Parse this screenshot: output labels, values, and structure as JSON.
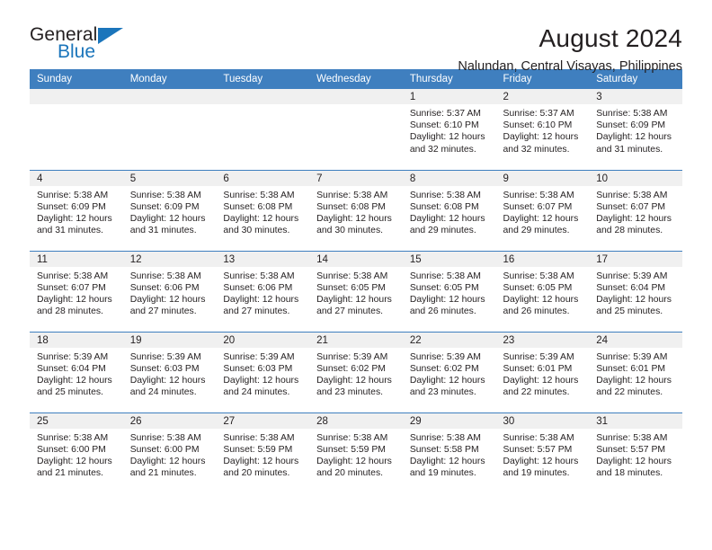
{
  "brand": {
    "name_top": "General",
    "name_bottom": "Blue",
    "accent_color": "#1b75bb"
  },
  "header": {
    "title": "August 2024",
    "subtitle": "Nalundan, Central Visayas, Philippines"
  },
  "calendar": {
    "header_bg": "#3f7fbf",
    "daynum_bg": "#f0f0f0",
    "weekdays": [
      "Sunday",
      "Monday",
      "Tuesday",
      "Wednesday",
      "Thursday",
      "Friday",
      "Saturday"
    ],
    "labels": {
      "sunrise": "Sunrise:",
      "sunset": "Sunset:",
      "daylight": "Daylight:"
    },
    "weeks": [
      [
        {
          "day": ""
        },
        {
          "day": ""
        },
        {
          "day": ""
        },
        {
          "day": ""
        },
        {
          "day": "1",
          "sunrise": "Sunrise: 5:37 AM",
          "sunset": "Sunset: 6:10 PM",
          "daylight_line1": "Daylight: 12 hours",
          "daylight_line2": "and 32 minutes."
        },
        {
          "day": "2",
          "sunrise": "Sunrise: 5:37 AM",
          "sunset": "Sunset: 6:10 PM",
          "daylight_line1": "Daylight: 12 hours",
          "daylight_line2": "and 32 minutes."
        },
        {
          "day": "3",
          "sunrise": "Sunrise: 5:38 AM",
          "sunset": "Sunset: 6:09 PM",
          "daylight_line1": "Daylight: 12 hours",
          "daylight_line2": "and 31 minutes."
        }
      ],
      [
        {
          "day": "4",
          "sunrise": "Sunrise: 5:38 AM",
          "sunset": "Sunset: 6:09 PM",
          "daylight_line1": "Daylight: 12 hours",
          "daylight_line2": "and 31 minutes."
        },
        {
          "day": "5",
          "sunrise": "Sunrise: 5:38 AM",
          "sunset": "Sunset: 6:09 PM",
          "daylight_line1": "Daylight: 12 hours",
          "daylight_line2": "and 31 minutes."
        },
        {
          "day": "6",
          "sunrise": "Sunrise: 5:38 AM",
          "sunset": "Sunset: 6:08 PM",
          "daylight_line1": "Daylight: 12 hours",
          "daylight_line2": "and 30 minutes."
        },
        {
          "day": "7",
          "sunrise": "Sunrise: 5:38 AM",
          "sunset": "Sunset: 6:08 PM",
          "daylight_line1": "Daylight: 12 hours",
          "daylight_line2": "and 30 minutes."
        },
        {
          "day": "8",
          "sunrise": "Sunrise: 5:38 AM",
          "sunset": "Sunset: 6:08 PM",
          "daylight_line1": "Daylight: 12 hours",
          "daylight_line2": "and 29 minutes."
        },
        {
          "day": "9",
          "sunrise": "Sunrise: 5:38 AM",
          "sunset": "Sunset: 6:07 PM",
          "daylight_line1": "Daylight: 12 hours",
          "daylight_line2": "and 29 minutes."
        },
        {
          "day": "10",
          "sunrise": "Sunrise: 5:38 AM",
          "sunset": "Sunset: 6:07 PM",
          "daylight_line1": "Daylight: 12 hours",
          "daylight_line2": "and 28 minutes."
        }
      ],
      [
        {
          "day": "11",
          "sunrise": "Sunrise: 5:38 AM",
          "sunset": "Sunset: 6:07 PM",
          "daylight_line1": "Daylight: 12 hours",
          "daylight_line2": "and 28 minutes."
        },
        {
          "day": "12",
          "sunrise": "Sunrise: 5:38 AM",
          "sunset": "Sunset: 6:06 PM",
          "daylight_line1": "Daylight: 12 hours",
          "daylight_line2": "and 27 minutes."
        },
        {
          "day": "13",
          "sunrise": "Sunrise: 5:38 AM",
          "sunset": "Sunset: 6:06 PM",
          "daylight_line1": "Daylight: 12 hours",
          "daylight_line2": "and 27 minutes."
        },
        {
          "day": "14",
          "sunrise": "Sunrise: 5:38 AM",
          "sunset": "Sunset: 6:05 PM",
          "daylight_line1": "Daylight: 12 hours",
          "daylight_line2": "and 27 minutes."
        },
        {
          "day": "15",
          "sunrise": "Sunrise: 5:38 AM",
          "sunset": "Sunset: 6:05 PM",
          "daylight_line1": "Daylight: 12 hours",
          "daylight_line2": "and 26 minutes."
        },
        {
          "day": "16",
          "sunrise": "Sunrise: 5:38 AM",
          "sunset": "Sunset: 6:05 PM",
          "daylight_line1": "Daylight: 12 hours",
          "daylight_line2": "and 26 minutes."
        },
        {
          "day": "17",
          "sunrise": "Sunrise: 5:39 AM",
          "sunset": "Sunset: 6:04 PM",
          "daylight_line1": "Daylight: 12 hours",
          "daylight_line2": "and 25 minutes."
        }
      ],
      [
        {
          "day": "18",
          "sunrise": "Sunrise: 5:39 AM",
          "sunset": "Sunset: 6:04 PM",
          "daylight_line1": "Daylight: 12 hours",
          "daylight_line2": "and 25 minutes."
        },
        {
          "day": "19",
          "sunrise": "Sunrise: 5:39 AM",
          "sunset": "Sunset: 6:03 PM",
          "daylight_line1": "Daylight: 12 hours",
          "daylight_line2": "and 24 minutes."
        },
        {
          "day": "20",
          "sunrise": "Sunrise: 5:39 AM",
          "sunset": "Sunset: 6:03 PM",
          "daylight_line1": "Daylight: 12 hours",
          "daylight_line2": "and 24 minutes."
        },
        {
          "day": "21",
          "sunrise": "Sunrise: 5:39 AM",
          "sunset": "Sunset: 6:02 PM",
          "daylight_line1": "Daylight: 12 hours",
          "daylight_line2": "and 23 minutes."
        },
        {
          "day": "22",
          "sunrise": "Sunrise: 5:39 AM",
          "sunset": "Sunset: 6:02 PM",
          "daylight_line1": "Daylight: 12 hours",
          "daylight_line2": "and 23 minutes."
        },
        {
          "day": "23",
          "sunrise": "Sunrise: 5:39 AM",
          "sunset": "Sunset: 6:01 PM",
          "daylight_line1": "Daylight: 12 hours",
          "daylight_line2": "and 22 minutes."
        },
        {
          "day": "24",
          "sunrise": "Sunrise: 5:39 AM",
          "sunset": "Sunset: 6:01 PM",
          "daylight_line1": "Daylight: 12 hours",
          "daylight_line2": "and 22 minutes."
        }
      ],
      [
        {
          "day": "25",
          "sunrise": "Sunrise: 5:38 AM",
          "sunset": "Sunset: 6:00 PM",
          "daylight_line1": "Daylight: 12 hours",
          "daylight_line2": "and 21 minutes."
        },
        {
          "day": "26",
          "sunrise": "Sunrise: 5:38 AM",
          "sunset": "Sunset: 6:00 PM",
          "daylight_line1": "Daylight: 12 hours",
          "daylight_line2": "and 21 minutes."
        },
        {
          "day": "27",
          "sunrise": "Sunrise: 5:38 AM",
          "sunset": "Sunset: 5:59 PM",
          "daylight_line1": "Daylight: 12 hours",
          "daylight_line2": "and 20 minutes."
        },
        {
          "day": "28",
          "sunrise": "Sunrise: 5:38 AM",
          "sunset": "Sunset: 5:59 PM",
          "daylight_line1": "Daylight: 12 hours",
          "daylight_line2": "and 20 minutes."
        },
        {
          "day": "29",
          "sunrise": "Sunrise: 5:38 AM",
          "sunset": "Sunset: 5:58 PM",
          "daylight_line1": "Daylight: 12 hours",
          "daylight_line2": "and 19 minutes."
        },
        {
          "day": "30",
          "sunrise": "Sunrise: 5:38 AM",
          "sunset": "Sunset: 5:57 PM",
          "daylight_line1": "Daylight: 12 hours",
          "daylight_line2": "and 19 minutes."
        },
        {
          "day": "31",
          "sunrise": "Sunrise: 5:38 AM",
          "sunset": "Sunset: 5:57 PM",
          "daylight_line1": "Daylight: 12 hours",
          "daylight_line2": "and 18 minutes."
        }
      ]
    ]
  }
}
